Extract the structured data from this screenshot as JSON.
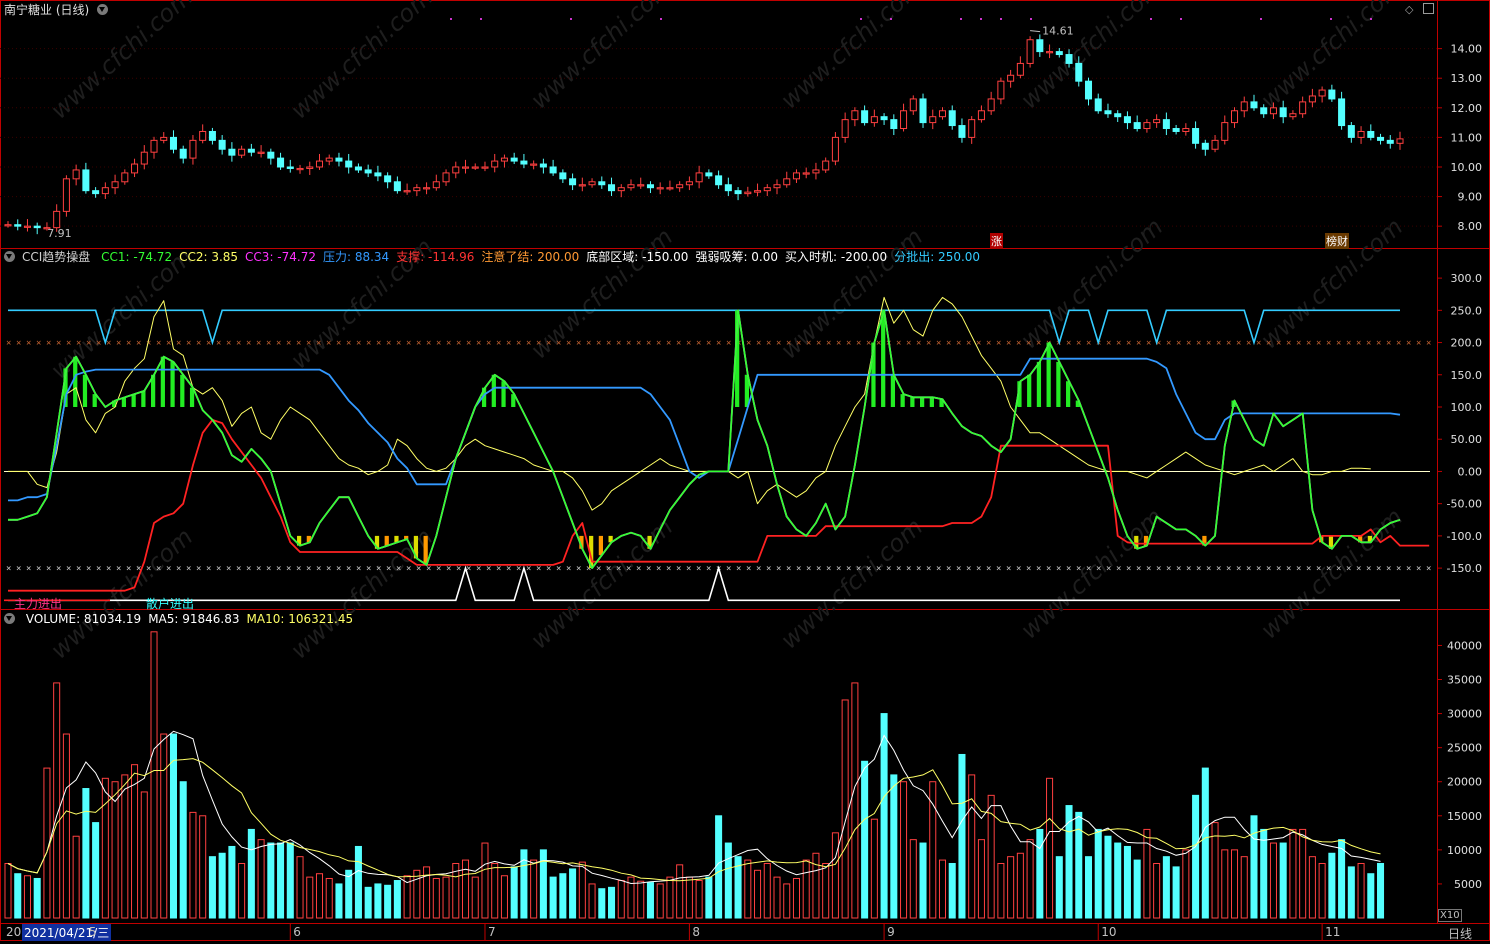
{
  "stock": {
    "title": "南宁糖业 (日线)",
    "high_label": "14.61",
    "low_label": "7.91",
    "marker_zhang": "涨",
    "marker_caisun": "榜财"
  },
  "price_axis": {
    "ticks": [
      "14.00",
      "13.00",
      "12.00",
      "11.00",
      "10.00",
      "9.00",
      "8.00"
    ],
    "values": [
      14,
      13,
      12,
      11,
      10,
      9,
      8
    ]
  },
  "cci_panel": {
    "name": "CCI趋势操盘",
    "legend": [
      {
        "label": "CC1: -74.72",
        "color": "#33ff33"
      },
      {
        "label": "CC2: 3.85",
        "color": "#ffff66"
      },
      {
        "label": "CC3: -74.72",
        "color": "#ff33ff"
      },
      {
        "label": "压力: 88.34",
        "color": "#3399ff"
      },
      {
        "label": "支撑: -114.96",
        "color": "#ff3333"
      },
      {
        "label": "注意了结: 200.00",
        "color": "#ff9933"
      },
      {
        "label": "底部区域: -150.00",
        "color": "#ffffff"
      },
      {
        "label": "强弱吸筹: 0.00",
        "color": "#ffffff"
      },
      {
        "label": "买入时机: -200.00",
        "color": "#ffffff"
      },
      {
        "label": "分批出: 250.00",
        "color": "#33ccff"
      }
    ],
    "ticks": [
      "300.0",
      "250.0",
      "200.0",
      "150.0",
      "100.0",
      "50.00",
      "0.00",
      "-50.00",
      "-100.0",
      "-150.0"
    ],
    "tick_values": [
      300,
      250,
      200,
      150,
      100,
      50,
      0,
      -50,
      -100,
      -150
    ],
    "label_main": "主力进出",
    "label_retail": "散户进出"
  },
  "volume_panel": {
    "legend": [
      {
        "label": "VOLUME: 81034.19",
        "color": "#ffffff"
      },
      {
        "label": "MA5: 91846.83",
        "color": "#ffffff"
      },
      {
        "label": "MA10: 106321.45",
        "color": "#ffff66"
      }
    ],
    "ticks": [
      "40000",
      "35000",
      "30000",
      "25000",
      "20000",
      "15000",
      "10000",
      "5000"
    ],
    "tick_values": [
      40000,
      35000,
      30000,
      25000,
      20000,
      15000,
      10000,
      5000
    ],
    "multiplier": "X10"
  },
  "date_axis": {
    "start": "20",
    "current_date": "2021/04/21/三",
    "months": [
      "5",
      "6",
      "7",
      "8",
      "9",
      "10",
      "11"
    ],
    "period": "日线"
  },
  "watermark": "www.cfchi.com",
  "chart_data": [
    {
      "type": "candlestick",
      "title": "南宁糖业 (日线)",
      "ylim": [
        7.6,
        14.9
      ],
      "annotations": [
        {
          "text": "14.61",
          "value": 14.61
        },
        {
          "text": "7.91",
          "value": 7.91
        }
      ],
      "close": [
        8.05,
        8.0,
        8.0,
        7.95,
        7.95,
        8.5,
        9.6,
        9.9,
        9.2,
        9.1,
        9.3,
        9.5,
        9.8,
        10.1,
        10.5,
        10.9,
        11.0,
        10.6,
        10.3,
        10.9,
        11.2,
        10.9,
        10.6,
        10.4,
        10.6,
        10.5,
        10.5,
        10.3,
        10.0,
        9.95,
        9.95,
        10.0,
        10.2,
        10.3,
        10.2,
        10.0,
        9.9,
        9.8,
        9.7,
        9.5,
        9.2,
        9.2,
        9.3,
        9.3,
        9.5,
        9.8,
        10.0,
        10.0,
        10.0,
        10.0,
        10.2,
        10.3,
        10.2,
        10.1,
        10.1,
        10.0,
        9.8,
        9.6,
        9.4,
        9.4,
        9.5,
        9.4,
        9.2,
        9.3,
        9.4,
        9.4,
        9.3,
        9.3,
        9.3,
        9.4,
        9.5,
        9.8,
        9.7,
        9.4,
        9.2,
        9.1,
        9.15,
        9.2,
        9.3,
        9.4,
        9.6,
        9.8,
        9.8,
        9.9,
        10.2,
        11.0,
        11.6,
        11.9,
        11.5,
        11.7,
        11.6,
        11.3,
        11.9,
        12.3,
        11.5,
        11.7,
        11.9,
        11.4,
        11.0,
        11.6,
        11.9,
        12.3,
        12.9,
        13.1,
        13.5,
        14.3,
        13.9,
        13.9,
        13.8,
        13.5,
        12.9,
        12.3,
        11.9,
        11.8,
        11.7,
        11.5,
        11.3,
        11.5,
        11.6,
        11.3,
        11.2,
        11.3,
        10.8,
        10.6,
        10.9,
        11.5,
        11.9,
        12.2,
        12.0,
        11.8,
        12.0,
        11.7,
        11.8,
        12.2,
        12.4,
        12.6,
        12.3,
        11.4,
        11.0,
        11.2,
        11.0,
        10.9,
        10.8,
        10.95
      ],
      "volume": [
        8000,
        6500,
        6200,
        5800,
        22000,
        34500,
        27000,
        12000,
        19000,
        14000,
        20500,
        20000,
        21000,
        22500,
        18500,
        42000,
        27000,
        27000,
        20000,
        15500,
        15000,
        9000,
        9500,
        10500,
        8000,
        13000,
        11500,
        11000,
        11000,
        11000,
        9000,
        6000,
        6500,
        5800,
        5000,
        7000,
        10500,
        4500,
        5000,
        4800,
        5500,
        6200,
        7000,
        7500,
        5800,
        6000,
        8000,
        8500,
        6000,
        11000,
        8000,
        6200,
        7500,
        10000,
        8500,
        10000,
        6000,
        6500,
        7200,
        8200,
        5000,
        4300,
        4500,
        5500,
        6000,
        5400,
        5200,
        5000,
        6000,
        7800,
        6000,
        5500,
        6000,
        15000,
        11000,
        9000,
        8500,
        7000,
        8000,
        6000,
        5000,
        5800,
        8500,
        9500,
        8000,
        12500,
        32000,
        34500,
        23000,
        14500,
        30000,
        21000,
        20000,
        11500,
        11000,
        20000,
        8500,
        8000,
        24000,
        21000,
        11500,
        18000,
        8000,
        9000,
        9500,
        11500,
        13000,
        20500,
        9000,
        16500,
        15500,
        9000,
        13000,
        12000,
        11000,
        10500,
        8500,
        13000,
        8000,
        9000,
        7500,
        10000,
        18000,
        22000,
        14000,
        10000,
        10000,
        9000,
        15000,
        13000,
        11000,
        11000,
        13000,
        13000,
        9000,
        8000,
        9500,
        11500,
        7500,
        8000,
        6500,
        8000
      ]
    },
    {
      "type": "line",
      "title": "CCI趋势操盘",
      "ylim": [
        -215,
        325
      ],
      "series": [
        {
          "name": "CC1",
          "values": [
            -75,
            -75,
            -70,
            -65,
            -40,
            60,
            160,
            178,
            150,
            120,
            100,
            110,
            115,
            120,
            125,
            150,
            178,
            170,
            150,
            130,
            95,
            80,
            60,
            25,
            15,
            35,
            20,
            0,
            -50,
            -100,
            -115,
            -110,
            -80,
            -60,
            -40,
            -40,
            -70,
            -100,
            -120,
            -115,
            -110,
            -105,
            -135,
            -145,
            -100,
            -40,
            20,
            60,
            100,
            130,
            150,
            140,
            120,
            90,
            60,
            30,
            0,
            -40,
            -80,
            -120,
            -150,
            -130,
            -110,
            -100,
            -95,
            -100,
            -120,
            -90,
            -60,
            -40,
            -20,
            -5,
            0,
            0,
            0,
            250,
            150,
            80,
            40,
            -20,
            -70,
            -90,
            -100,
            -80,
            -50,
            -90,
            -70,
            10,
            100,
            200,
            250,
            150,
            120,
            115,
            115,
            115,
            112,
            90,
            70,
            60,
            55,
            40,
            30,
            50,
            140,
            150,
            170,
            200,
            170,
            140,
            110,
            70,
            30,
            -10,
            -60,
            -100,
            -120,
            -115,
            -70,
            -80,
            -90,
            -90,
            -100,
            -115,
            -100,
            40,
            110,
            80,
            50,
            40,
            90,
            70,
            80,
            90,
            -60,
            -110,
            -120,
            -100,
            -100,
            -110,
            -110,
            -90,
            -80,
            -75
          ]
        },
        {
          "name": "CC2",
          "values": [
            0,
            0,
            0,
            -20,
            -25,
            30,
            120,
            130,
            80,
            60,
            90,
            100,
            140,
            160,
            175,
            240,
            265,
            190,
            180,
            130,
            120,
            130,
            110,
            70,
            90,
            100,
            60,
            50,
            80,
            100,
            90,
            80,
            60,
            40,
            20,
            10,
            5,
            -5,
            0,
            10,
            50,
            40,
            20,
            5,
            0,
            5,
            20,
            40,
            50,
            40,
            35,
            30,
            25,
            20,
            10,
            5,
            0,
            0,
            -10,
            -30,
            -60,
            -50,
            -30,
            -20,
            -10,
            0,
            10,
            20,
            10,
            5,
            0,
            0,
            0,
            0,
            0,
            -10,
            0,
            -50,
            -30,
            -20,
            -30,
            -40,
            -30,
            -10,
            0,
            40,
            70,
            100,
            120,
            200,
            270,
            230,
            250,
            220,
            210,
            250,
            270,
            260,
            240,
            210,
            180,
            160,
            140,
            100,
            80,
            60,
            60,
            50,
            40,
            30,
            20,
            10,
            5,
            0,
            0,
            0,
            -5,
            -10,
            0,
            10,
            20,
            30,
            20,
            10,
            5,
            0,
            -5,
            0,
            5,
            10,
            0,
            10,
            20,
            0,
            -5,
            -5,
            0,
            0,
            5,
            5,
            4
          ]
        },
        {
          "name": "CC3",
          "values": [
            -75,
            -75,
            -70,
            -65,
            -40,
            60,
            160,
            178,
            150,
            120,
            100,
            110,
            115,
            120,
            125,
            150,
            178,
            170,
            150,
            130,
            95,
            80,
            60,
            25,
            15,
            35,
            20,
            0,
            -50,
            -100,
            -115,
            -110,
            -80,
            -60,
            -40,
            -40,
            -70,
            -100,
            -120,
            -115,
            -110,
            -105,
            -135,
            -145,
            -100,
            -40,
            20,
            60,
            100,
            130,
            150,
            140,
            120,
            90,
            60,
            30,
            0,
            -40,
            -80,
            -120,
            -150,
            -130,
            -110,
            -100,
            -95,
            -100,
            -120,
            -90,
            -60,
            -40,
            -20,
            -5,
            0,
            0,
            0,
            250,
            150,
            80,
            40,
            -20,
            -70,
            -90,
            -100,
            -80,
            -50,
            -90,
            -70,
            10,
            100,
            200,
            250,
            150,
            120,
            115,
            115,
            115,
            112,
            90,
            70,
            60,
            55,
            40,
            30,
            50,
            140,
            150,
            170,
            200,
            170,
            140,
            110,
            70,
            30,
            -10,
            -60,
            -100,
            -120,
            -115,
            -70,
            -80,
            -90,
            -90,
            -100,
            -115,
            -100,
            40,
            110,
            80,
            50,
            40,
            90,
            70,
            80,
            90,
            -60,
            -110,
            -120,
            -100,
            -100,
            -110,
            -110,
            -90,
            -80,
            -75
          ]
        },
        {
          "name": "压力",
          "values": [
            -45,
            -45,
            -40,
            -40,
            -35,
            40,
            120,
            150,
            155,
            158,
            158,
            158,
            158,
            158,
            158,
            158,
            158,
            158,
            158,
            158,
            158,
            158,
            158,
            158,
            158,
            158,
            158,
            158,
            158,
            158,
            158,
            158,
            158,
            150,
            130,
            110,
            95,
            75,
            60,
            45,
            20,
            5,
            -20,
            -20,
            -20,
            -20,
            20,
            60,
            100,
            120,
            130,
            130,
            130,
            130,
            130,
            130,
            130,
            130,
            130,
            130,
            130,
            130,
            130,
            130,
            130,
            130,
            120,
            100,
            80,
            40,
            0,
            -10,
            0,
            0,
            0,
            50,
            100,
            150,
            150,
            150,
            150,
            150,
            150,
            150,
            150,
            150,
            150,
            150,
            150,
            150,
            150,
            150,
            150,
            150,
            150,
            150,
            150,
            150,
            150,
            150,
            150,
            150,
            150,
            150,
            150,
            175,
            175,
            175,
            175,
            175,
            175,
            175,
            175,
            175,
            175,
            175,
            175,
            175,
            170,
            160,
            120,
            90,
            60,
            50,
            50,
            80,
            90,
            90,
            90,
            90,
            90,
            90,
            90,
            90,
            90,
            90,
            90,
            90,
            90,
            90,
            90,
            90,
            90,
            88
          ]
        },
        {
          "name": "支撑",
          "values": [
            -185,
            -185,
            -185,
            -185,
            -185,
            -185,
            -185,
            -185,
            -185,
            -185,
            -185,
            -185,
            -185,
            -180,
            -140,
            -80,
            -70,
            -65,
            -50,
            10,
            60,
            80,
            75,
            50,
            30,
            10,
            -10,
            -40,
            -70,
            -110,
            -125,
            -125,
            -125,
            -125,
            -125,
            -125,
            -125,
            -125,
            -125,
            -125,
            -125,
            -135,
            -145,
            -145,
            -145,
            -145,
            -145,
            -145,
            -145,
            -145,
            -145,
            -145,
            -145,
            -145,
            -145,
            -145,
            -145,
            -140,
            -100,
            -80,
            -140,
            -140,
            -140,
            -140,
            -140,
            -140,
            -140,
            -140,
            -140,
            -140,
            -140,
            -140,
            -140,
            -140,
            -140,
            -140,
            -140,
            -140,
            -100,
            -100,
            -100,
            -100,
            -100,
            -100,
            -85,
            -85,
            -85,
            -85,
            -85,
            -85,
            -85,
            -85,
            -85,
            -85,
            -85,
            -85,
            -85,
            -80,
            -80,
            -80,
            -70,
            -40,
            40,
            40,
            40,
            40,
            40,
            40,
            40,
            40,
            40,
            40,
            40,
            40,
            -100,
            -110,
            -112,
            -112,
            -112,
            -112,
            -112,
            -112,
            -112,
            -112,
            -112,
            -112,
            -112,
            -112,
            -112,
            -112,
            -112,
            -112,
            -112,
            -112,
            -112,
            -100,
            -100,
            -100,
            -100,
            -100,
            -90,
            -110,
            -100,
            -115,
            -115,
            -115,
            -115
          ]
        }
      ]
    },
    {
      "type": "bar",
      "title": "VOLUME",
      "ylim": [
        0,
        43000
      ],
      "series": [
        {
          "name": "VOLUME"
        },
        {
          "name": "MA5"
        },
        {
          "name": "MA10"
        }
      ]
    }
  ]
}
